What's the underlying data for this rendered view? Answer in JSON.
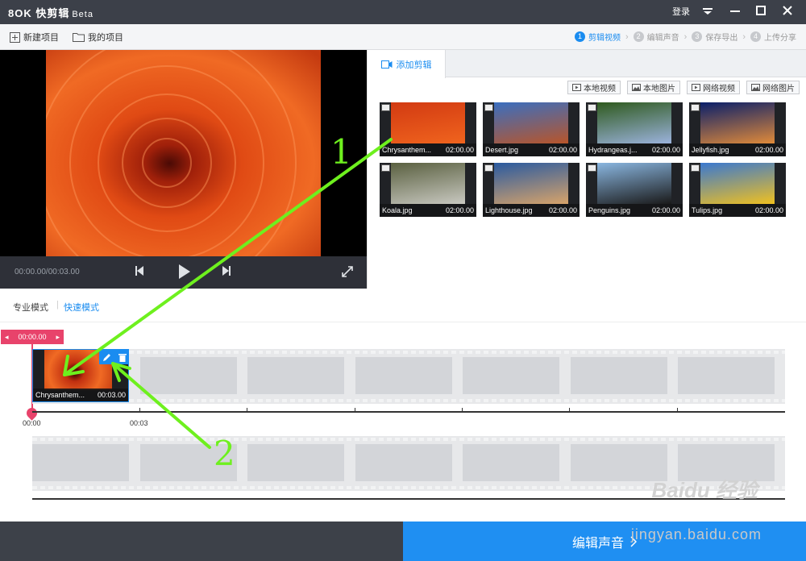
{
  "app": {
    "logo": "8OK 快剪辑",
    "beta": "Beta",
    "login": "登录"
  },
  "toolbar": {
    "new_project": "新建项目",
    "my_projects": "我的项目"
  },
  "steps": [
    {
      "num": "1",
      "label": "剪辑视频",
      "active": true
    },
    {
      "num": "2",
      "label": "编辑声音",
      "active": false
    },
    {
      "num": "3",
      "label": "保存导出",
      "active": false
    },
    {
      "num": "4",
      "label": "上传分享",
      "active": false
    }
  ],
  "player": {
    "timecode": "00:00.00/00:03.00"
  },
  "media": {
    "tab": "添加剪辑",
    "sources": [
      "本地视频",
      "本地图片",
      "网络视频",
      "网络图片"
    ],
    "items": [
      {
        "name": "Chrysanthem...",
        "duration": "02:00.00",
        "colors": [
          "#d23a12",
          "#f0641e"
        ]
      },
      {
        "name": "Desert.jpg",
        "duration": "02:00.00",
        "colors": [
          "#3a6fc0",
          "#b8552a"
        ]
      },
      {
        "name": "Hydrangeas.j...",
        "duration": "02:00.00",
        "colors": [
          "#2f5a1e",
          "#9bb2dc"
        ]
      },
      {
        "name": "Jellyfish.jpg",
        "duration": "02:00.00",
        "colors": [
          "#0a1f6a",
          "#e08a3a"
        ]
      },
      {
        "name": "Koala.jpg",
        "duration": "02:00.00",
        "colors": [
          "#5a6040",
          "#c8c8c0"
        ]
      },
      {
        "name": "Lighthouse.jpg",
        "duration": "02:00.00",
        "colors": [
          "#2a5aa0",
          "#d7a36a"
        ]
      },
      {
        "name": "Penguins.jpg",
        "duration": "02:00.00",
        "colors": [
          "#8ab6e0",
          "#1a1a1a"
        ]
      },
      {
        "name": "Tulips.jpg",
        "duration": "02:00.00",
        "colors": [
          "#3a78d0",
          "#f0c020"
        ]
      }
    ]
  },
  "modes": {
    "pro": "专业模式",
    "quick": "快速模式"
  },
  "timeline": {
    "playhead": "00:00.00",
    "clip_name": "Chrysanthem...",
    "clip_duration": "00:03.00",
    "ticks": [
      "00:00",
      "00:03"
    ]
  },
  "footer": {
    "next": "编辑声音"
  },
  "annotations": [
    "1",
    "2"
  ],
  "watermark": {
    "logo": "Baidu 经验",
    "url": "jingyan.baidu.com"
  },
  "colors": {
    "accent": "#1f8ff2",
    "playhead": "#e8436b",
    "arrow": "#6ef01e"
  }
}
